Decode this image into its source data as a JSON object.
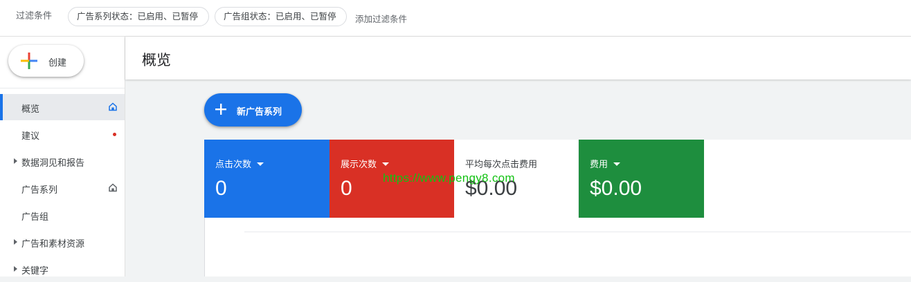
{
  "filter_bar": {
    "label": "过滤条件",
    "chips": [
      {
        "text": "广告系列状态：已启用、已暂停"
      },
      {
        "text": "广告组状态：已启用、已暂停"
      }
    ],
    "add_filter": "添加过滤条件"
  },
  "sidebar": {
    "create_label": "创建",
    "items": [
      {
        "label": "概览",
        "active": true,
        "icon": "home-icon"
      },
      {
        "label": "建议",
        "badge": "red-dot"
      },
      {
        "label": "数据洞见和报告",
        "expandable": true
      },
      {
        "label": "广告系列",
        "icon": "home-icon"
      },
      {
        "label": "广告组"
      },
      {
        "label": "广告和素材资源",
        "expandable": true
      },
      {
        "label": "关键字",
        "expandable": true
      }
    ]
  },
  "header": {
    "title": "概览"
  },
  "main": {
    "new_campaign_label": "新广告系列",
    "metrics": [
      {
        "label": "点击次数",
        "value": "0",
        "color": "#1a73e8",
        "dropdown": true
      },
      {
        "label": "展示次数",
        "value": "0",
        "color": "#d93025",
        "dropdown": true
      },
      {
        "label": "平均每次点击费用",
        "value": "$0.00",
        "color": "#ffffff",
        "dropdown": false
      },
      {
        "label": "费用",
        "value": "$0.00",
        "color": "#1e8e3e",
        "dropdown": true
      }
    ]
  },
  "watermark": "https://www.pengy8.com",
  "colors": {
    "accent": "#1a73e8",
    "red": "#d93025",
    "green": "#1e8e3e"
  }
}
